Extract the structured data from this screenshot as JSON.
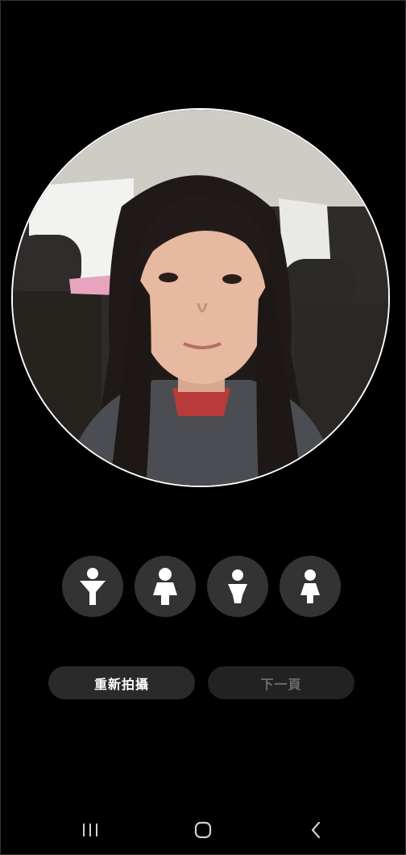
{
  "camera_preview": {
    "subject": "face-photo"
  },
  "body_types": [
    {
      "icon": "male-body-type-1-icon"
    },
    {
      "icon": "female-body-type-1-icon"
    },
    {
      "icon": "male-body-type-2-icon"
    },
    {
      "icon": "female-body-type-2-icon"
    }
  ],
  "actions": {
    "retake_label": "重新拍攝",
    "next_label": "下一頁"
  },
  "nav": {
    "recent": "recent-apps-icon",
    "home": "home-icon",
    "back": "back-icon"
  },
  "colors": {
    "background": "#000000",
    "button_bg": "#2a2a2a",
    "icon_circle": "#333333",
    "disabled_text": "#6e6e6e"
  }
}
